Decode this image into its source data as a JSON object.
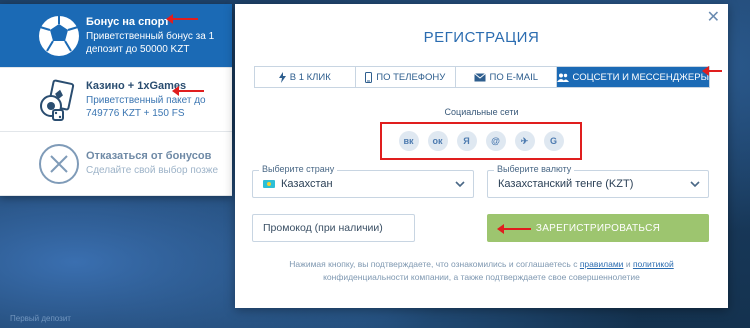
{
  "background": {
    "strip_texts": [
      "Первый депозит",
      "",
      "",
      "",
      ""
    ]
  },
  "bonuses": [
    {
      "title": "Бонус на спорт",
      "desc": "Приветственный бонус за 1 депозит до 50000 KZT",
      "icon": "soccer-ball-icon",
      "active": true
    },
    {
      "title": "Казино + 1xGames",
      "desc": "Приветственный пакет до 749776 KZT + 150 FS",
      "icon": "casino-cards-icon",
      "active": false
    },
    {
      "title": "Отказаться от бонусов",
      "desc": "Сделайте свой выбор позже",
      "icon": "close-circle-icon",
      "active": false
    }
  ],
  "modal": {
    "title": "РЕГИСТРАЦИЯ",
    "close_icon": "close-icon",
    "tabs": [
      {
        "label": "В 1 КЛИК",
        "icon": "lightning-icon"
      },
      {
        "label": "ПО ТЕЛЕФОНУ",
        "icon": "phone-icon"
      },
      {
        "label": "ПО E-MAIL",
        "icon": "envelope-icon"
      },
      {
        "label": "СОЦСЕТИ И МЕССЕНДЖЕРЫ",
        "icon": "people-icon",
        "active": true
      }
    ],
    "social_label": "Социальные сети",
    "social": [
      {
        "name": "vk",
        "glyph": "вк"
      },
      {
        "name": "odnoklassniki",
        "glyph": "ок"
      },
      {
        "name": "yandex",
        "glyph": "Я"
      },
      {
        "name": "mail",
        "glyph": "@"
      },
      {
        "name": "telegram",
        "glyph": "✈"
      },
      {
        "name": "google",
        "glyph": "G"
      }
    ],
    "country_label": "Выберите страну",
    "country_value": "Казахстан",
    "currency_label": "Выберите валюту",
    "currency_value": "Казахстанский тенге (KZT)",
    "promo_placeholder": "Промокод (при наличии)",
    "register_label": "ЗАРЕГИСТРИРОВАТЬСЯ",
    "disclaimer_1": "Нажимая кнопку, вы подтверждаете, что ознакомились и соглашаетесь с",
    "link_rules": "правилами",
    "conj_and": "и",
    "link_policy": "политикой",
    "disclaimer_2": "конфиденциальности компании, а также подтверждаете свое совершеннолетие"
  },
  "colors": {
    "accent": "#1b6ab5",
    "register_button": "#9dc56f",
    "annotation_red": "#e01e1e"
  }
}
